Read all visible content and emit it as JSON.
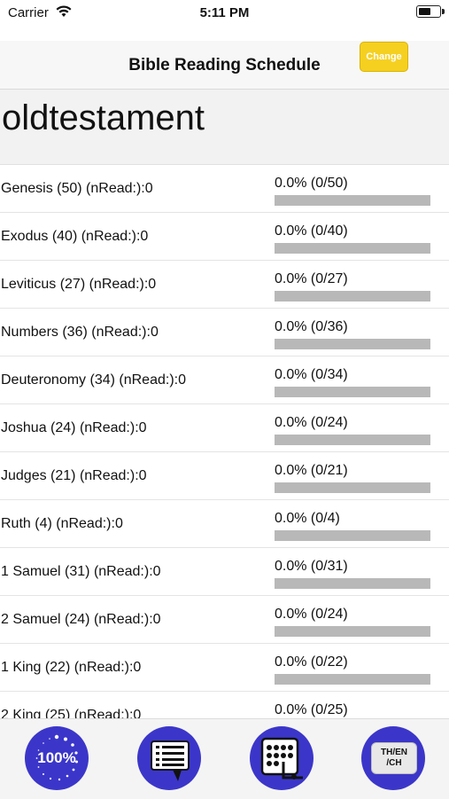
{
  "status_bar": {
    "carrier": "Carrier",
    "time": "5:11 PM"
  },
  "nav": {
    "title": "Bible Reading Schedule",
    "change_label": "Change"
  },
  "section": {
    "title": "oldtestament"
  },
  "books": [
    {
      "name": "Genesis (50)  (nRead:):0",
      "percent": "0.0%  (0/50)",
      "progress": 0
    },
    {
      "name": "Exodus (40)  (nRead:):0",
      "percent": "0.0%  (0/40)",
      "progress": 0
    },
    {
      "name": "Leviticus (27)  (nRead:):0",
      "percent": "0.0%  (0/27)",
      "progress": 0
    },
    {
      "name": "Numbers (36)  (nRead:):0",
      "percent": "0.0%  (0/36)",
      "progress": 0
    },
    {
      "name": "Deuteronomy (34)  (nRead:):0",
      "percent": "0.0%  (0/34)",
      "progress": 0
    },
    {
      "name": "Joshua (24)  (nRead:):0",
      "percent": "0.0%  (0/24)",
      "progress": 0
    },
    {
      "name": "Judges (21)  (nRead:):0",
      "percent": "0.0%  (0/21)",
      "progress": 0
    },
    {
      "name": "Ruth (4)  (nRead:):0",
      "percent": "0.0%  (0/4)",
      "progress": 0
    },
    {
      "name": "1 Samuel (31)  (nRead:):0",
      "percent": "0.0%  (0/31)",
      "progress": 0
    },
    {
      "name": "2 Samuel (24)  (nRead:):0",
      "percent": "0.0%  (0/24)",
      "progress": 0
    },
    {
      "name": "1 King (22)  (nRead:):0",
      "percent": "0.0%  (0/22)",
      "progress": 0
    },
    {
      "name": "2 King (25)  (nRead:):0",
      "percent": "0.0%  (0/25)",
      "progress": 0
    }
  ],
  "tab_bar": {
    "progress_label": "100%",
    "lang_label": "TH/EN\n/CH",
    "icons": [
      "progress-circle-icon",
      "list-chat-icon",
      "calendar-grid-icon",
      "language-icon"
    ]
  },
  "colors": {
    "tab_button": "#3b36c9",
    "change_button": "#f5d021",
    "progress_track": "#b8b8b8"
  }
}
